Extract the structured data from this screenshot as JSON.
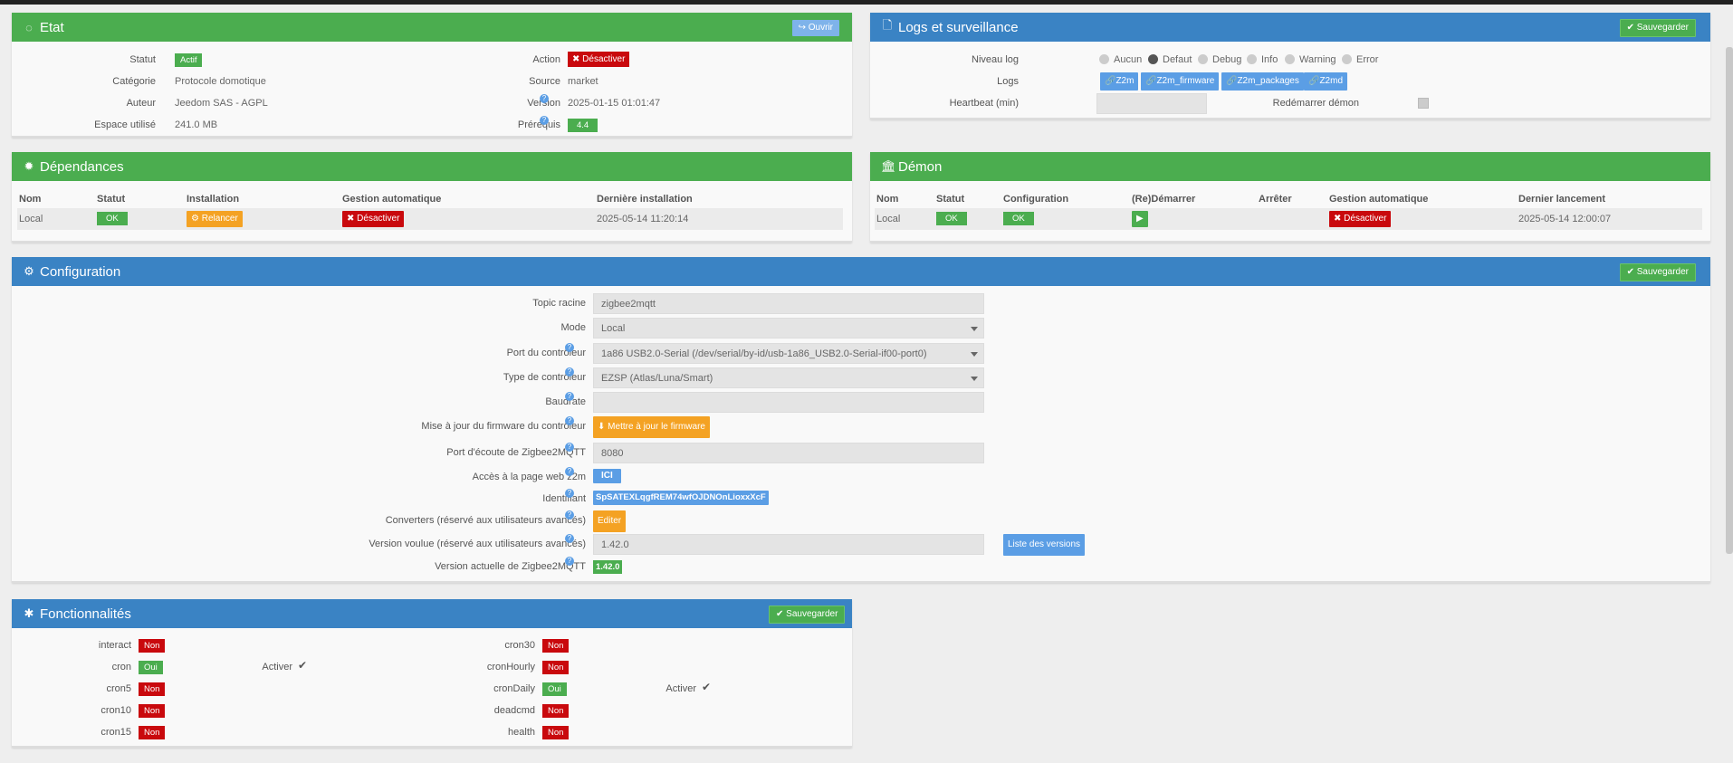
{
  "etat": {
    "title": "Etat",
    "open_label": "Ouvrir",
    "statut_label": "Statut",
    "statut_value": "Actif",
    "categorie_label": "Catégorie",
    "categorie_value": "Protocole domotique",
    "auteur_label": "Auteur",
    "auteur_value": "Jeedom SAS - AGPL",
    "espace_label": "Espace utilisé",
    "espace_value": "241.0 MB",
    "action_label": "Action",
    "action_value": "Désactiver",
    "source_label": "Source",
    "source_value": "market",
    "version_label": "Version",
    "version_value": "2025-01-15 01:01:47",
    "prerequis_label": "Prérequis",
    "prerequis_value": "4.4"
  },
  "logs": {
    "title": "Logs et surveillance",
    "save_label": "Sauvegarder",
    "niveau_label": "Niveau log",
    "levels": [
      "Aucun",
      "Defaut",
      "Debug",
      "Info",
      "Warning",
      "Error"
    ],
    "selected_level": "Defaut",
    "logs_label": "Logs",
    "log_buttons": [
      "Z2m",
      "Z2m_firmware",
      "Z2m_packages",
      "Z2md"
    ],
    "heartbeat_label": "Heartbeat (min)",
    "heartbeat_value": "",
    "restart_label": "Redémarrer démon"
  },
  "dependances": {
    "title": "Dépendances",
    "headers": [
      "Nom",
      "Statut",
      "Installation",
      "Gestion automatique",
      "Dernière installation"
    ],
    "row": {
      "nom": "Local",
      "statut": "OK",
      "installation": "Relancer",
      "gestion": "Désactiver",
      "derniere": "2025-05-14 11:20:14"
    }
  },
  "demon": {
    "title": "Démon",
    "headers": [
      "Nom",
      "Statut",
      "Configuration",
      "(Re)Démarrer",
      "Arrêter",
      "Gestion automatique",
      "Dernier lancement"
    ],
    "row": {
      "nom": "Local",
      "statut": "OK",
      "configuration": "OK",
      "gestion": "Désactiver",
      "dernier": "2025-05-14 12:00:07"
    }
  },
  "configuration": {
    "title": "Configuration",
    "save_label": "Sauvegarder",
    "topic_label": "Topic racine",
    "topic_value": "zigbee2mqtt",
    "mode_label": "Mode",
    "mode_value": "Local",
    "port_label": "Port du contrôleur",
    "port_value": "1a86 USB2.0-Serial (/dev/serial/by-id/usb-1a86_USB2.0-Serial-if00-port0)",
    "type_label": "Type de contrôleur",
    "type_value": "EZSP (Atlas/Luna/Smart)",
    "baudrate_label": "Baudrate",
    "baudrate_value": "",
    "firmware_label": "Mise à jour du firmware du contrôleur",
    "firmware_button": "Mettre à jour le firmware",
    "listen_label": "Port d'écoute de Zigbee2MQTT",
    "listen_value": "8080",
    "web_label": "Accès à la page web z2m",
    "web_button": "ICI",
    "ident_label": "Identifiant",
    "ident_value": "SpSATEXLqgfREM74wfOJDNOnLioxxXcF",
    "converters_label": "Converters (réservé aux utilisateurs avancés)",
    "converters_button": "Editer",
    "wanted_label": "Version voulue (réservé aux utilisateurs avancés)",
    "wanted_value": "1.42.0",
    "versions_button": "Liste des versions",
    "current_label": "Version actuelle de Zigbee2MQTT",
    "current_value": "1.42.0"
  },
  "fonctionnalites": {
    "title": "Fonctionnalités",
    "save_label": "Sauvegarder",
    "activer_label": "Activer",
    "left": [
      {
        "name": "interact",
        "value": "Non"
      },
      {
        "name": "cron",
        "value": "Oui"
      },
      {
        "name": "cron5",
        "value": "Non"
      },
      {
        "name": "cron10",
        "value": "Non"
      },
      {
        "name": "cron15",
        "value": "Non"
      }
    ],
    "right": [
      {
        "name": "cron30",
        "value": "Non"
      },
      {
        "name": "cronHourly",
        "value": "Non"
      },
      {
        "name": "cronDaily",
        "value": "Oui"
      },
      {
        "name": "deadcmd",
        "value": "Non"
      },
      {
        "name": "health",
        "value": "Non"
      }
    ]
  }
}
